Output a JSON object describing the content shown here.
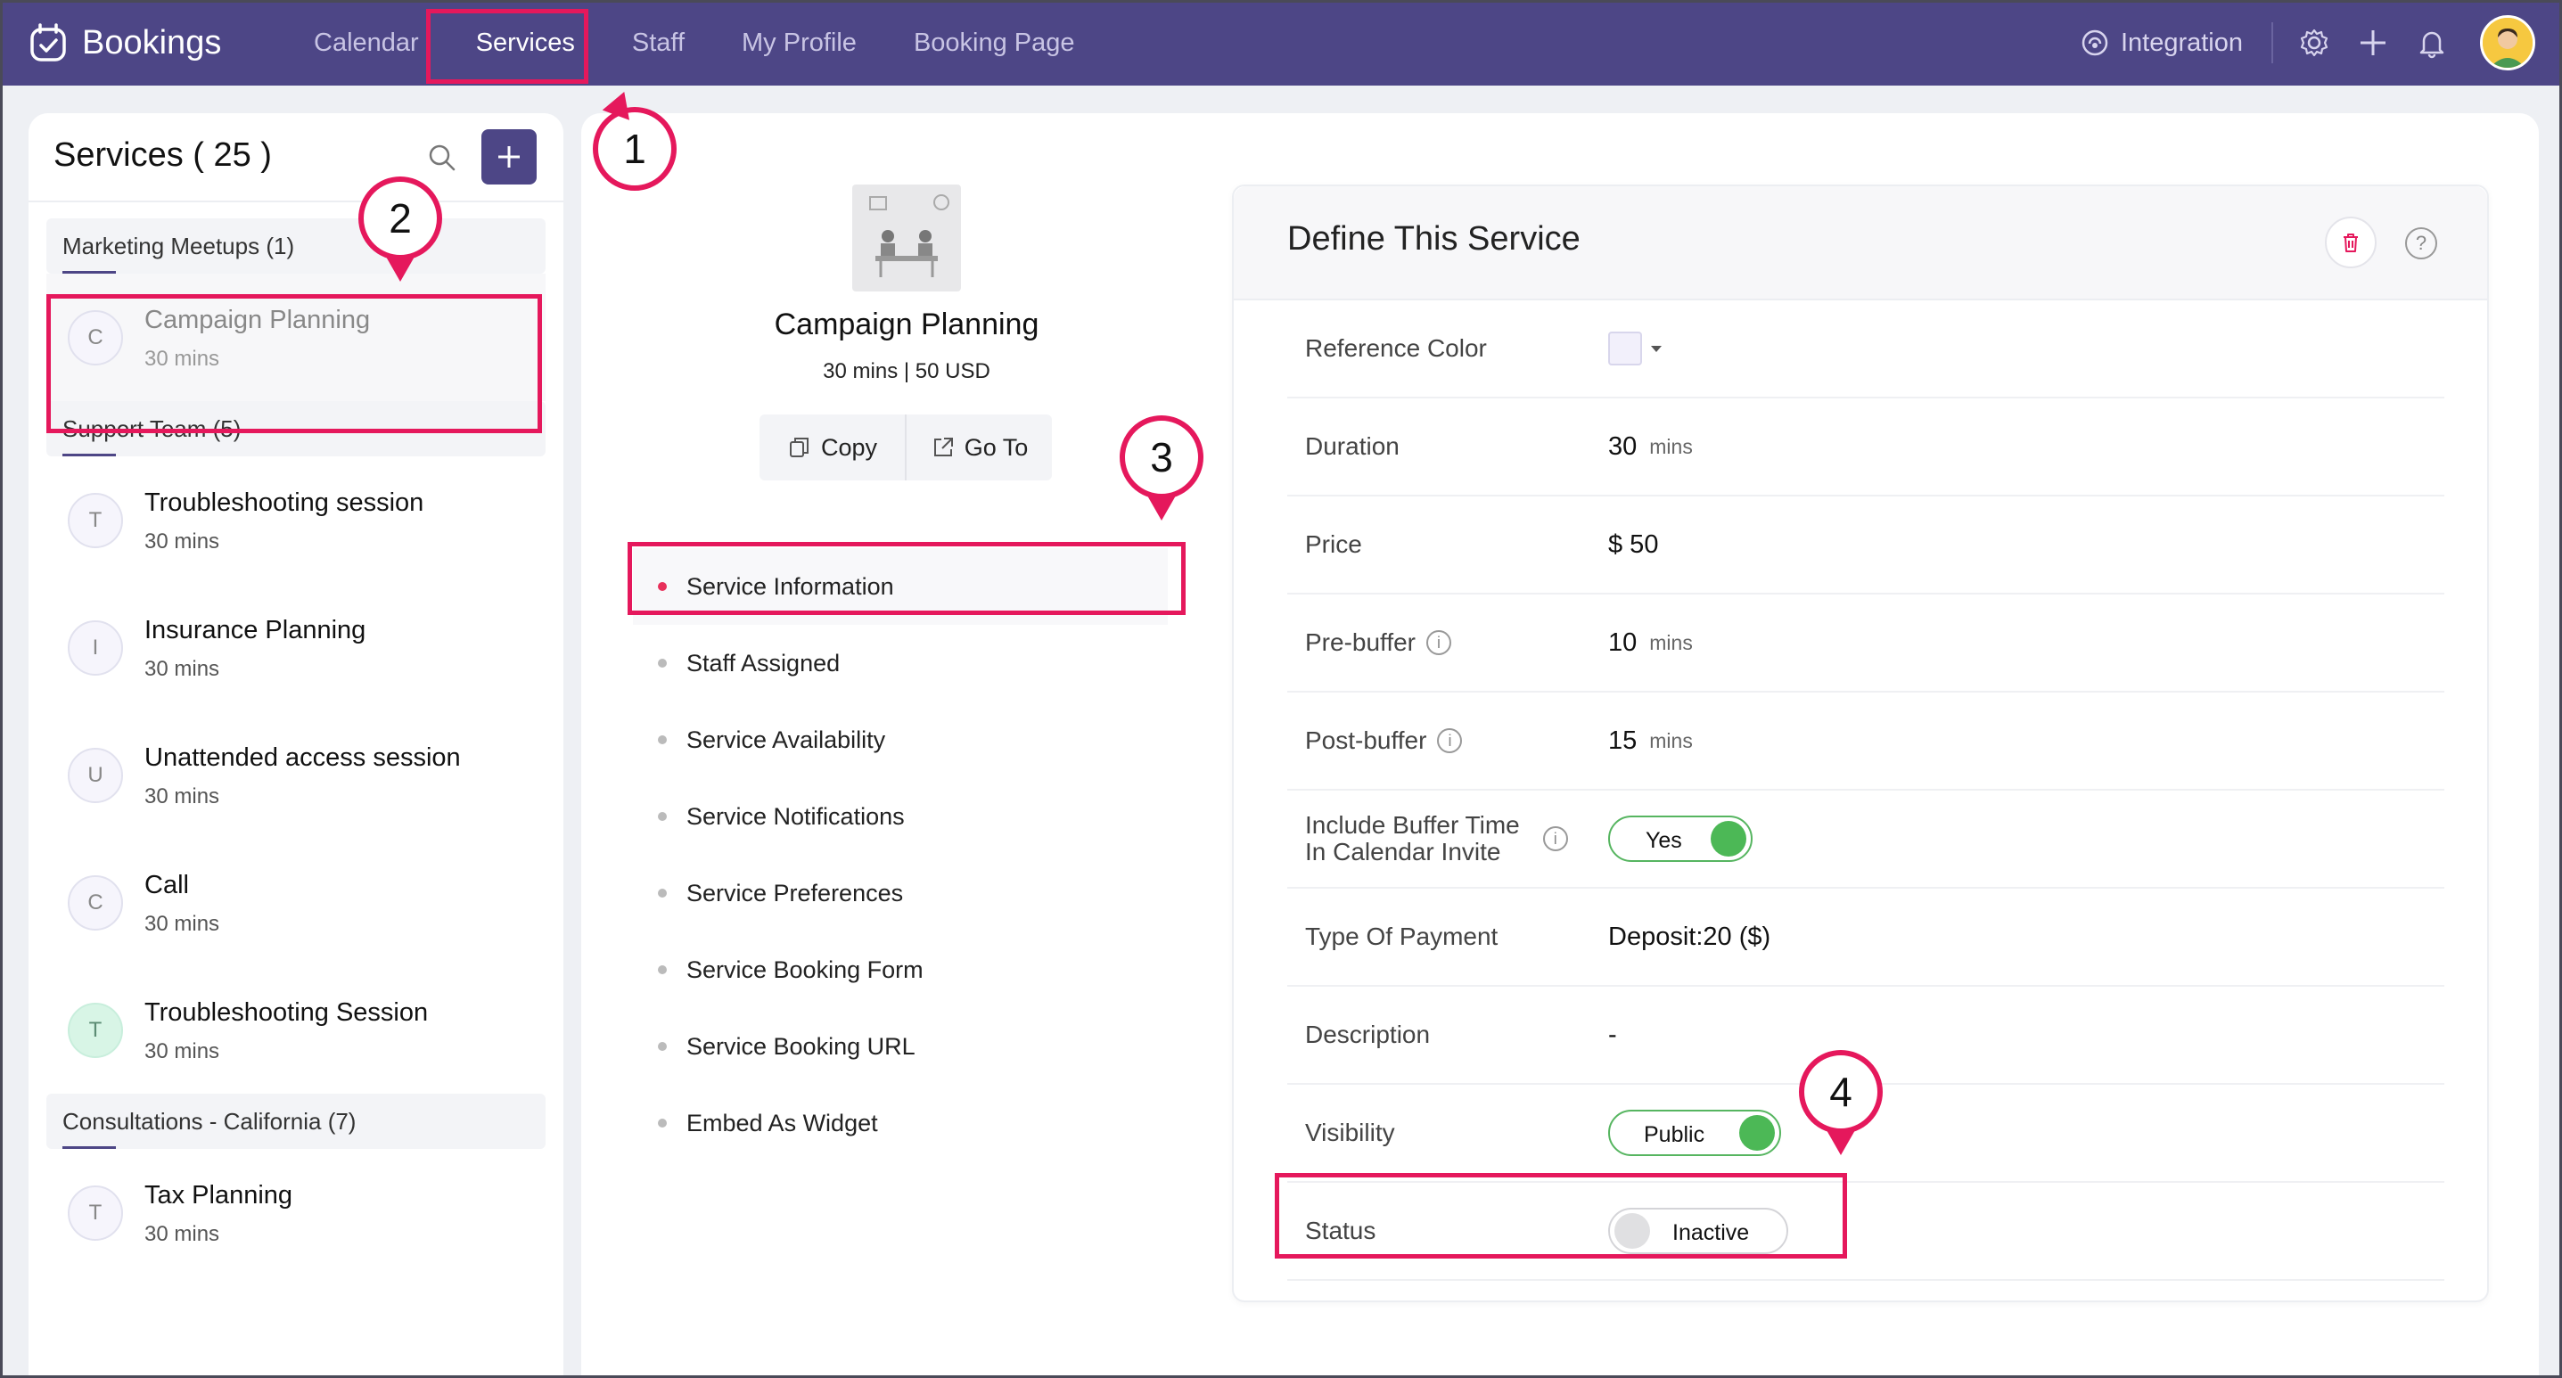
{
  "app": {
    "name": "Bookings"
  },
  "nav": {
    "items": [
      {
        "label": "Calendar"
      },
      {
        "label": "Services"
      },
      {
        "label": "Staff"
      },
      {
        "label": "My Profile"
      },
      {
        "label": "Booking Page"
      }
    ],
    "active": "Services",
    "integration_label": "Integration"
  },
  "services_panel": {
    "title": "Services ( 25 )",
    "groups": [
      {
        "label": "Marketing Meetups (1)",
        "items": [
          {
            "initial": "C",
            "name": "Campaign Planning",
            "duration": "30 mins",
            "selected": true
          }
        ]
      },
      {
        "label": "Support Team (5)",
        "items": [
          {
            "initial": "T",
            "name": "Troubleshooting session",
            "duration": "30 mins"
          },
          {
            "initial": "I",
            "name": "Insurance Planning",
            "duration": "30 mins"
          },
          {
            "initial": "U",
            "name": "Unattended access session",
            "duration": "30 mins"
          },
          {
            "initial": "C",
            "name": "Call",
            "duration": "30 mins"
          },
          {
            "initial": "T",
            "name": "Troubleshooting Session",
            "duration": "30 mins"
          }
        ]
      },
      {
        "label": "Consultations - California (7)",
        "items": [
          {
            "initial": "T",
            "name": "Tax Planning",
            "duration": "30 mins"
          }
        ]
      }
    ]
  },
  "service": {
    "title": "Campaign Planning",
    "meta": "30 mins | 50 USD",
    "copy_label": "Copy",
    "goto_label": "Go To"
  },
  "menu": [
    {
      "label": "Service Information",
      "active": true
    },
    {
      "label": "Staff Assigned"
    },
    {
      "label": "Service Availability"
    },
    {
      "label": "Service Notifications"
    },
    {
      "label": "Service Preferences"
    },
    {
      "label": "Service Booking Form"
    },
    {
      "label": "Service Booking URL"
    },
    {
      "label": "Embed As Widget"
    }
  ],
  "define": {
    "title": "Define This Service",
    "reference_color_label": "Reference Color",
    "duration_label": "Duration",
    "duration_value": "30",
    "duration_unit": "mins",
    "price_label": "Price",
    "price_value": "$ 50",
    "prebuffer_label": "Pre-buffer",
    "prebuffer_value": "10",
    "prebuffer_unit": "mins",
    "postbuffer_label": "Post-buffer",
    "postbuffer_value": "15",
    "postbuffer_unit": "mins",
    "include_buffer_label_1": "Include Buffer Time",
    "include_buffer_label_2": "In Calendar Invite",
    "include_buffer_value": "Yes",
    "payment_label": "Type Of Payment",
    "payment_value": "Deposit:20 ($)",
    "description_label": "Description",
    "description_value": "-",
    "visibility_label": "Visibility",
    "visibility_value": "Public",
    "status_label": "Status",
    "status_value": "Inactive"
  },
  "callouts": {
    "c1": "1",
    "c2": "2",
    "c3": "3",
    "c4": "4"
  },
  "colors": {
    "brand": "#4d4686",
    "highlight": "#e5185c",
    "toggle_on": "#4cb856"
  }
}
